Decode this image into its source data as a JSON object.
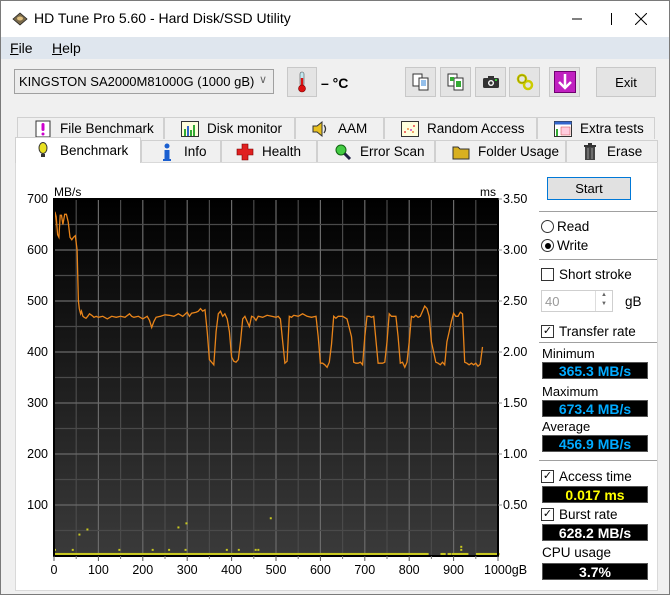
{
  "window": {
    "title": "HD Tune Pro 5.60 - Hard Disk/SSD Utility",
    "controls": [
      "minimize",
      "maximize",
      "close"
    ]
  },
  "menu": [
    {
      "label": "File",
      "accel": "F",
      "rest": "ile"
    },
    {
      "label": "Help",
      "accel": "H",
      "rest": "elp"
    }
  ],
  "toolbar": {
    "drive": "KINGSTON SA2000M81000G (1000 gB)",
    "temperature": "– °C",
    "icons": [
      "copy-text-icon",
      "copy-screenshot-icon",
      "camera-icon",
      "options-icon",
      "download-icon"
    ],
    "exit_label": "Exit"
  },
  "tabs_row1": [
    {
      "label": "File Benchmark",
      "icon": "file-benchmark-icon"
    },
    {
      "label": "Disk monitor",
      "icon": "disk-monitor-icon"
    },
    {
      "label": "AAM",
      "icon": "speaker-icon"
    },
    {
      "label": "Random Access",
      "icon": "random-access-icon"
    },
    {
      "label": "Extra tests",
      "icon": "extra-tests-icon"
    }
  ],
  "tabs_row2": [
    {
      "label": "Benchmark",
      "icon": "exclamation-bulb-icon",
      "active": true
    },
    {
      "label": "Info",
      "icon": "info-icon"
    },
    {
      "label": "Health",
      "icon": "health-cross-icon"
    },
    {
      "label": "Error Scan",
      "icon": "magnifier-icon"
    },
    {
      "label": "Folder Usage",
      "icon": "folder-icon"
    },
    {
      "label": "Erase",
      "icon": "trash-icon"
    }
  ],
  "side": {
    "start_label": "Start",
    "read_label": "Read",
    "write_label": "Write",
    "mode": "Write",
    "short_stroke_label": "Short stroke",
    "short_stroke_checked": false,
    "short_stroke_value": "40",
    "short_stroke_unit": "gB",
    "transfer_rate_label": "Transfer rate",
    "transfer_rate_checked": true,
    "minimum_label": "Minimum",
    "minimum_value": "365.3 MB/s",
    "maximum_label": "Maximum",
    "maximum_value": "673.4 MB/s",
    "average_label": "Average",
    "average_value": "456.9 MB/s",
    "access_time_label": "Access time",
    "access_time_checked": true,
    "access_time_value": "0.017 ms",
    "burst_rate_label": "Burst rate",
    "burst_rate_checked": true,
    "burst_rate_value": "628.2 MB/s",
    "cpu_usage_label": "CPU usage",
    "cpu_usage_value": "3.7%"
  },
  "colors": {
    "transfer_line": "#e8841a",
    "access_dots": "#c8c820",
    "stat_cyan": "#00aaff",
    "stat_yellow": "#ffff00"
  },
  "chart_data": {
    "type": "line",
    "xlabel": "gB",
    "ylabel_left": "MB/s",
    "ylabel_right": "ms",
    "xlim": [
      0,
      1000
    ],
    "ylim_left": [
      0,
      700
    ],
    "ylim_right": [
      0,
      3.5
    ],
    "x_ticks": [
      "0",
      "100",
      "200",
      "300",
      "400",
      "500",
      "600",
      "700",
      "800",
      "900",
      "1000gB"
    ],
    "y_ticks_left": [
      "700",
      "600",
      "500",
      "400",
      "300",
      "200",
      "100"
    ],
    "y_ticks_right": [
      "3.50",
      "3.00",
      "2.50",
      "2.00",
      "1.50",
      "1.00",
      "0.50"
    ],
    "grid": true,
    "series": [
      {
        "name": "Transfer rate (MB/s)",
        "x": [
          0,
          2,
          5,
          8,
          11,
          14,
          17,
          20,
          24,
          28,
          32,
          36,
          40,
          44,
          48,
          52,
          55,
          57,
          60,
          62,
          65,
          68,
          72,
          76,
          80,
          85,
          90,
          95,
          100,
          110,
          120,
          130,
          140,
          150,
          160,
          170,
          175,
          180,
          190,
          200,
          210,
          215,
          220,
          225,
          230,
          240,
          250,
          260,
          270,
          280,
          290,
          300,
          305,
          310,
          320,
          325,
          330,
          335,
          340,
          345,
          350,
          355,
          360,
          365,
          370,
          375,
          380,
          385,
          390,
          395,
          400,
          405,
          410,
          415,
          420,
          425,
          430,
          435,
          440,
          445,
          450,
          455,
          460,
          470,
          480,
          490,
          500,
          505,
          510,
          515,
          520,
          525,
          530,
          535,
          540,
          550,
          560,
          570,
          580,
          590,
          595,
          600,
          605,
          610,
          615,
          620,
          625,
          630,
          635,
          640,
          650,
          660,
          670,
          675,
          680,
          685,
          690,
          695,
          700,
          705,
          710,
          715,
          720,
          730,
          740,
          745,
          750,
          755,
          760,
          770,
          775,
          780,
          785,
          790,
          795,
          800,
          805,
          810,
          815,
          820,
          825,
          830,
          835,
          840,
          845,
          850,
          860,
          865,
          870,
          875,
          880,
          885,
          890,
          895,
          900,
          905,
          910,
          915,
          920,
          925,
          930,
          935,
          940,
          945,
          950,
          955,
          960,
          965,
          970,
          975,
          980,
          985,
          990,
          995,
          1000
        ],
        "y": [
          590,
          675,
          665,
          630,
          625,
          668,
          668,
          650,
          670,
          670,
          655,
          625,
          620,
          625,
          628,
          600,
          500,
          485,
          475,
          480,
          470,
          468,
          466,
          470,
          475,
          472,
          468,
          470,
          468,
          470,
          465,
          470,
          468,
          470,
          468,
          475,
          470,
          468,
          470,
          465,
          470,
          462,
          448,
          460,
          468,
          470,
          473,
          472,
          470,
          475,
          470,
          478,
          470,
          476,
          478,
          480,
          485,
          480,
          483,
          440,
          385,
          380,
          375,
          440,
          475,
          480,
          470,
          475,
          465,
          440,
          390,
          382,
          380,
          385,
          420,
          465,
          470,
          460,
          450,
          470,
          468,
          462,
          470,
          468,
          472,
          470,
          468,
          470,
          465,
          420,
          378,
          382,
          470,
          468,
          472,
          470,
          475,
          470,
          468,
          470,
          430,
          378,
          378,
          375,
          370,
          380,
          415,
          470,
          466,
          470,
          470,
          465,
          430,
          380,
          378,
          378,
          380,
          375,
          430,
          470,
          470,
          468,
          470,
          378,
          378,
          380,
          420,
          475,
          470,
          470,
          430,
          378,
          380,
          370,
          380,
          420,
          470,
          468,
          472,
          468,
          470,
          480,
          490,
          485,
          470,
          420,
          380,
          378,
          375,
          380,
          375,
          420,
          440,
          460,
          476,
          470,
          470,
          478,
          475,
          380,
          378,
          375,
          378,
          375,
          378,
          372,
          376,
          410
        ]
      },
      {
        "name": "Access time (ms)",
        "type": "scatter",
        "baseline_ms": 0.02,
        "outliers": [
          [
            55,
            0.21
          ],
          [
            73,
            0.26
          ],
          [
            278,
            0.28
          ],
          [
            296,
            0.32
          ],
          [
            486,
            0.37
          ],
          [
            0,
            0.06
          ],
          [
            40,
            0.06
          ],
          [
            145,
            0.06
          ],
          [
            220,
            0.06
          ],
          [
            257,
            0.06
          ],
          [
            294,
            0.06
          ],
          [
            387,
            0.06
          ],
          [
            414,
            0.06
          ],
          [
            452,
            0.06
          ],
          [
            458,
            0.06
          ],
          [
            915,
            0.06
          ],
          [
            915,
            0.09
          ]
        ]
      }
    ]
  }
}
